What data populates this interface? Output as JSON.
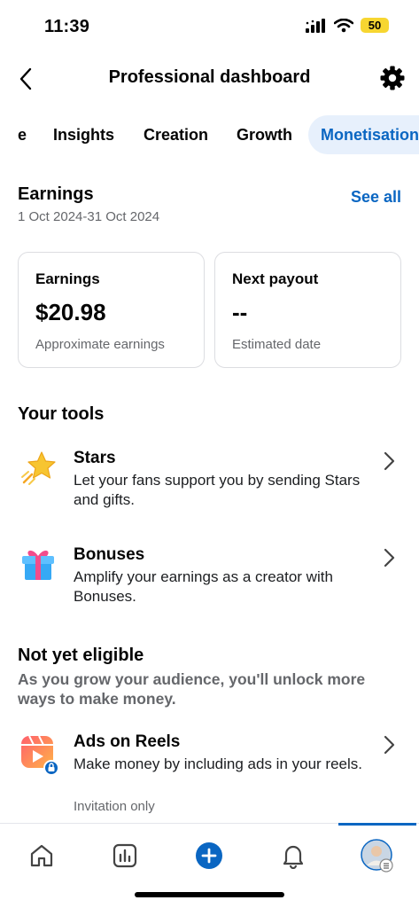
{
  "status": {
    "time": "11:39",
    "battery": "50"
  },
  "header": {
    "title": "Professional dashboard"
  },
  "tabs": [
    {
      "label": "e"
    },
    {
      "label": "Insights"
    },
    {
      "label": "Creation"
    },
    {
      "label": "Growth"
    },
    {
      "label": "Monetisation"
    }
  ],
  "earnings": {
    "title": "Earnings",
    "date_range": "1 Oct 2024-31 Oct 2024",
    "see_all": "See all",
    "cards": [
      {
        "label": "Earnings",
        "value": "$20.98",
        "sub": "Approximate earnings"
      },
      {
        "label": "Next payout",
        "value": "--",
        "sub": "Estimated date"
      }
    ]
  },
  "tools": {
    "title": "Your tools",
    "items": [
      {
        "title": "Stars",
        "desc": "Let your fans support you by sending Stars and gifts.",
        "icon": "star-icon"
      },
      {
        "title": "Bonuses",
        "desc": "Amplify your earnings as a creator with Bonuses.",
        "icon": "gift-icon"
      }
    ]
  },
  "not_eligible": {
    "title": "Not yet eligible",
    "desc": "As you grow your audience, you'll unlock more ways to make money.",
    "items": [
      {
        "title": "Ads on Reels",
        "desc": "Make money by including ads in your reels.",
        "note": "Invitation only",
        "icon": "reels-ads-icon"
      }
    ]
  },
  "colors": {
    "accent": "#0a66c2",
    "tab_active_bg": "#e7f0fc"
  }
}
